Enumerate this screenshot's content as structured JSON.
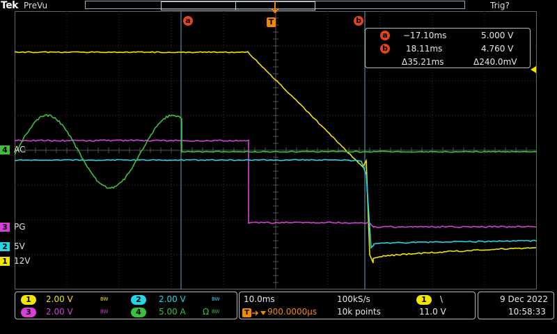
{
  "header": {
    "logo": "Tek",
    "mode": "PreVu",
    "trigger_state": "Trig?"
  },
  "cursors": {
    "a_label": "a",
    "b_label": "b",
    "trigger_label": "T"
  },
  "readout": {
    "a_time": "−17.10ms",
    "a_volt": "5.000 V",
    "b_time": "18.11ms",
    "b_volt": "4.760 V",
    "delta_time": "Δ35.21ms",
    "delta_volt": "Δ240.0mV"
  },
  "channels": {
    "ch4_label": "AC",
    "ch3_label": "PG",
    "ch2_label": "5V",
    "ch1_label": "12V",
    "ch1_num": "1",
    "ch2_num": "2",
    "ch3_num": "3",
    "ch4_num": "4"
  },
  "colors": {
    "ch1": "#f2e600",
    "ch2": "#22d6e6",
    "ch3": "#d83ed8",
    "ch4": "#3cc03c",
    "cursor": "#e0451c",
    "trigger": "#f08a00"
  },
  "bottom": {
    "ch1_scale": "2.00 V",
    "ch2_scale": "2.00 V",
    "ch3_scale": "2.00 V",
    "ch4_scale": "5.00 A",
    "bw_label": "BW",
    "ohm_label": "Ω",
    "timebase": "10.0ms",
    "sample_rate": "100kS/s",
    "trigger_pos": "900.0000µs",
    "record_length": "10k points",
    "trig_source": "1",
    "trig_slope": "\\",
    "trig_level": "11.0 V",
    "date": "9 Dec  2022",
    "time": "10:58:33"
  }
}
